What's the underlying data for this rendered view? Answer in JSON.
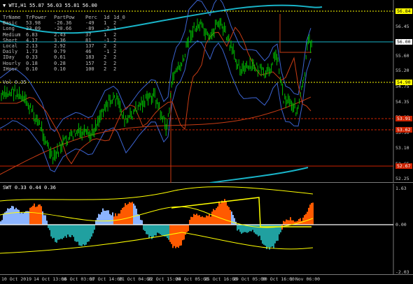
{
  "main_header": "WTI,H1  55.87 56.03 55.81 56.00",
  "sub_header": "SWT 0.33 0.44 0.36",
  "vol_label": "Vol 0.35",
  "table": {
    "headers": [
      "TrName",
      "TrPower",
      "PartPow",
      "Perc",
      "1d",
      "1d_0"
    ],
    "rows": [
      [
        "Basic",
        "53.98",
        "-26.36",
        "-49",
        "1",
        "2"
      ],
      [
        "Long",
        "23.09",
        "-20.66",
        "-89",
        "-2",
        "1"
      ],
      [
        "Medium",
        "6.83",
        "2.43",
        "37",
        "1",
        "2"
      ],
      [
        "Short",
        "4.17",
        "3.36",
        "81",
        "-1",
        "2"
      ],
      [
        "Local",
        "2.13",
        "2.92",
        "137",
        "2",
        "2"
      ],
      [
        "Daily",
        "1.73",
        "0.79",
        "46",
        "-1",
        "2"
      ],
      [
        "IDay",
        "0.33",
        "0.61",
        "183",
        "2",
        "2"
      ],
      [
        "Hourly",
        "0.18",
        "0.28",
        "157",
        "2",
        "2"
      ],
      [
        "IHour",
        "0.10",
        "0.10",
        "100",
        "2",
        "2"
      ]
    ]
  },
  "price_scale": [
    "56.45",
    "56.00",
    "55.60",
    "55.20",
    "54.75",
    "54.35",
    "53.90",
    "53.50",
    "53.10",
    "52.65",
    "52.25"
  ],
  "price_tags": [
    {
      "text": "56.84",
      "bg": "#ffff00",
      "fg": "#000000"
    },
    {
      "text": "56.00",
      "bg": "#ffffff",
      "fg": "#000000"
    },
    {
      "text": "54.90",
      "bg": "#ffff00",
      "fg": "#000000"
    },
    {
      "text": "53.91",
      "bg": "#cc2200",
      "fg": "#ffffff"
    },
    {
      "text": "53.62",
      "bg": "#cc2200",
      "fg": "#ffffff"
    },
    {
      "text": "52.67",
      "bg": "#cc2200",
      "fg": "#ffffff"
    }
  ],
  "sub_scale": [
    "1.63",
    "0.00",
    "-2.03"
  ],
  "time_labels": [
    "10 Oct 2019",
    "14 Oct 13:00",
    "16 Oct 03:00",
    "17 Oct 14:00",
    "21 Oct 04:00",
    "22 Oct 15:00",
    "24 Oct 05:00",
    "25 Oct 16:00",
    "29 Oct 05:00",
    "30 Oct 16:00",
    "1 Nov 06:00"
  ],
  "colors": {
    "candles": "#00c000",
    "ma_red": "#c83c14",
    "band_blue": "#3c64d2",
    "band_cyan": "#19b4c8",
    "yellow": "#ffff00",
    "orange_hist": "#ff5a00",
    "teal_hist": "#20a0a0",
    "lightblue_hist": "#8cb4ff"
  }
}
